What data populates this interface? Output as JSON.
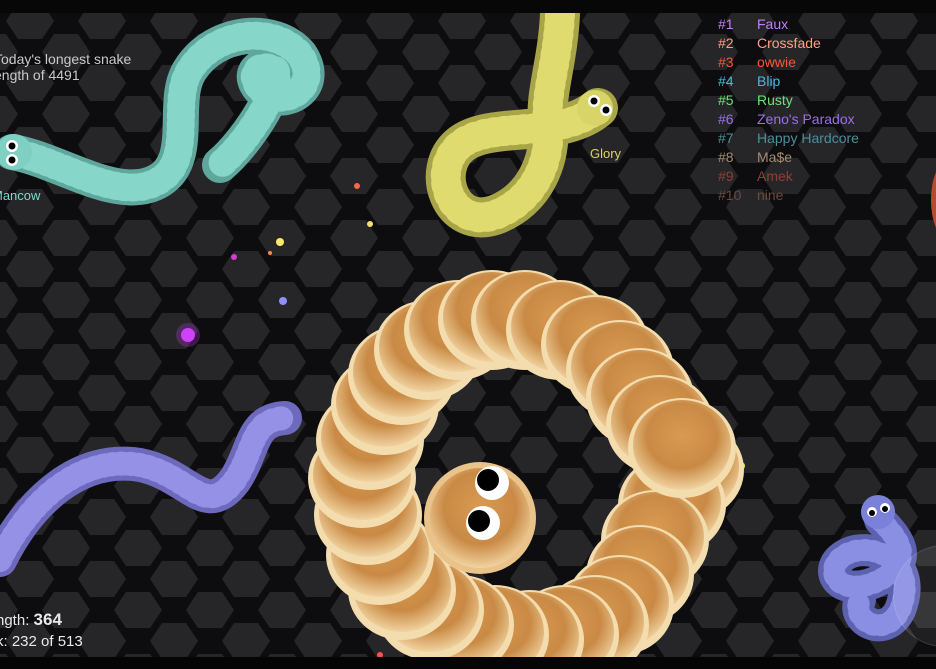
{
  "best": {
    "line1": "Today's longest snake",
    "line2": "ength of 4491"
  },
  "stats": {
    "length_label": "ngth:",
    "length_value": "364",
    "rank_label": "k:",
    "rank_value": "232 of 513"
  },
  "leaderboard": [
    {
      "rank": "#1",
      "name": "Faux",
      "color": "#c37bff"
    },
    {
      "rank": "#2",
      "name": "Crossfade",
      "color": "#ff9f85"
    },
    {
      "rank": "#3",
      "name": "owwie",
      "color": "#ff5432"
    },
    {
      "rank": "#4",
      "name": "Blip",
      "color": "#4fb5df"
    },
    {
      "rank": "#5",
      "name": "Rusty",
      "color": "#6fe07a"
    },
    {
      "rank": "#6",
      "name": "Zeno's Paradox",
      "color": "#9a70e6"
    },
    {
      "rank": "#7",
      "name": "Happy Hardcore",
      "color": "#4b8f9a"
    },
    {
      "rank": "#8",
      "name": "Ma$e",
      "color": "#a48c6e"
    },
    {
      "rank": "#9",
      "name": "Amek",
      "color": "#8c4036"
    },
    {
      "rank": "#10",
      "name": "nine",
      "color": "#6b4a3e"
    }
  ],
  "nicknames": {
    "mancow": "Mancow",
    "glory": "Glory"
  },
  "colors": {
    "background": "#0d0d0f",
    "hex_tile": "#262629",
    "teal_snake": "#7fcfc2",
    "yellow_snake": "#d8d468",
    "purple_snake": "#8c88de",
    "blue_snake": "#7b80d8",
    "pancake": "#e6b471"
  }
}
